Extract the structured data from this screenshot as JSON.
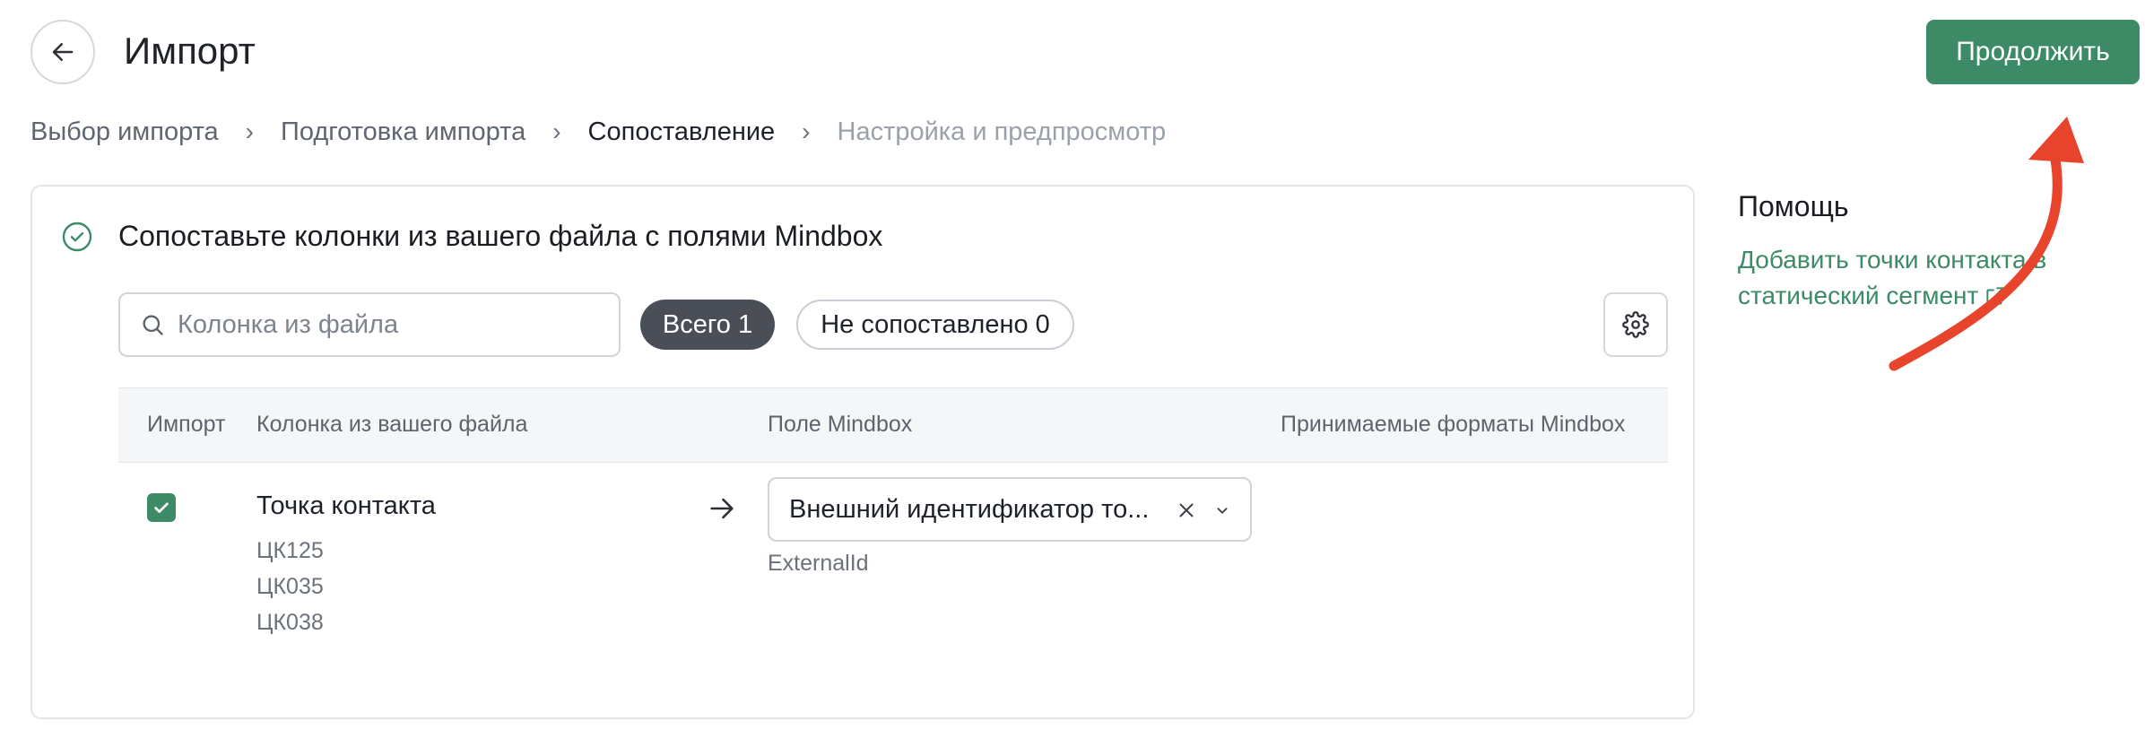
{
  "header": {
    "back_icon": "arrow-left-icon",
    "title": "Импорт",
    "continue_label": "Продолжить",
    "accent_color": "#3c8a66"
  },
  "breadcrumb": {
    "steps": [
      {
        "label": "Выбор импорта",
        "state": "done"
      },
      {
        "label": "Подготовка импорта",
        "state": "done"
      },
      {
        "label": "Сопоставление",
        "state": "current"
      },
      {
        "label": "Настройка и предпросмотр",
        "state": "future"
      }
    ],
    "separator_icon": "chevron-right-icon"
  },
  "mapping": {
    "title": "Сопоставьте колонки из вашего файла с полями Mindbox",
    "status_icon": "check-circle-icon",
    "search": {
      "placeholder": "Колонка из файла",
      "icon": "search-icon"
    },
    "filters": {
      "all_label": "Всего 1",
      "unmatched_label": "Не сопоставлено 0"
    },
    "settings_icon": "gear-icon",
    "columns": {
      "import": "Импорт",
      "file_column": "Колонка из вашего файла",
      "mindbox_field": "Поле Mindbox",
      "formats": "Принимаемые форматы Mindbox"
    },
    "rows": [
      {
        "checked": true,
        "name": "Точка контакта",
        "samples": [
          "ЦК125",
          "ЦК035",
          "ЦК038"
        ],
        "field_value": "Внешний идентификатор то...",
        "field_system_name": "ExternalId",
        "formats": ""
      }
    ]
  },
  "help": {
    "title": "Помощь",
    "link_text": "Добавить точки контакта в статический сегмент",
    "link_icon": "external-link-icon"
  },
  "annotation": {
    "color": "#e8432b",
    "icon": "curved-arrow-icon"
  }
}
